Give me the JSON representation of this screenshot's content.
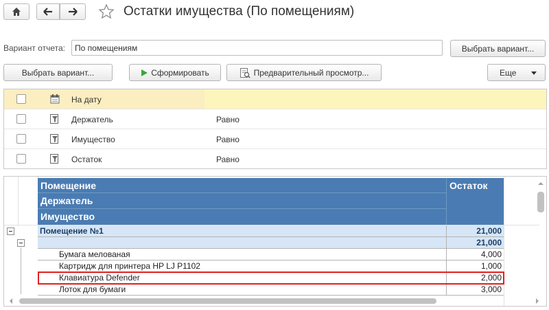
{
  "window": {
    "title": "Остатки имущества (По помещениям)"
  },
  "variant": {
    "label": "Вариант отчета:",
    "value": "По помещениям",
    "select_button": "Выбрать вариант..."
  },
  "toolbar": {
    "choose_variant": "Выбрать вариант...",
    "generate": "Сформировать",
    "preview": "Предварительный просмотр...",
    "more": "Еще"
  },
  "settings": [
    {
      "label": "На дату",
      "condition": ""
    },
    {
      "label": "Держатель",
      "condition": "Равно"
    },
    {
      "label": "Имущество",
      "condition": "Равно"
    },
    {
      "label": "Остаток",
      "condition": "Равно"
    }
  ],
  "report": {
    "headers": {
      "room": "Помещение",
      "holder": "Держатель",
      "property": "Имущество",
      "balance": "Остаток"
    },
    "group_room": {
      "name": "Помещение №1",
      "value": "21,000"
    },
    "group_holder": {
      "name": "",
      "value": "21,000"
    },
    "rows": [
      {
        "name": "Бумага мелованая",
        "value": "4,000"
      },
      {
        "name": "Картридж для принтера HP LJ P1102",
        "value": "1,000"
      },
      {
        "name": "Клавиатура Defender",
        "value": "2,000"
      },
      {
        "name": "Лоток для бумаги",
        "value": "3,000"
      }
    ]
  },
  "colors": {
    "header_blue": "#4a7cb3",
    "group_fill": "#d6e6f6",
    "highlight_row": "#fcf6bc",
    "selection_border": "#e02020",
    "generate_icon": "#3aa53a"
  },
  "icons": {
    "home": "home-icon",
    "back": "arrow-left-icon",
    "forward": "arrow-right-icon",
    "favorite": "star-icon",
    "generate": "play-icon",
    "preview": "document-preview-icon",
    "more": "triangle-down-icon"
  }
}
